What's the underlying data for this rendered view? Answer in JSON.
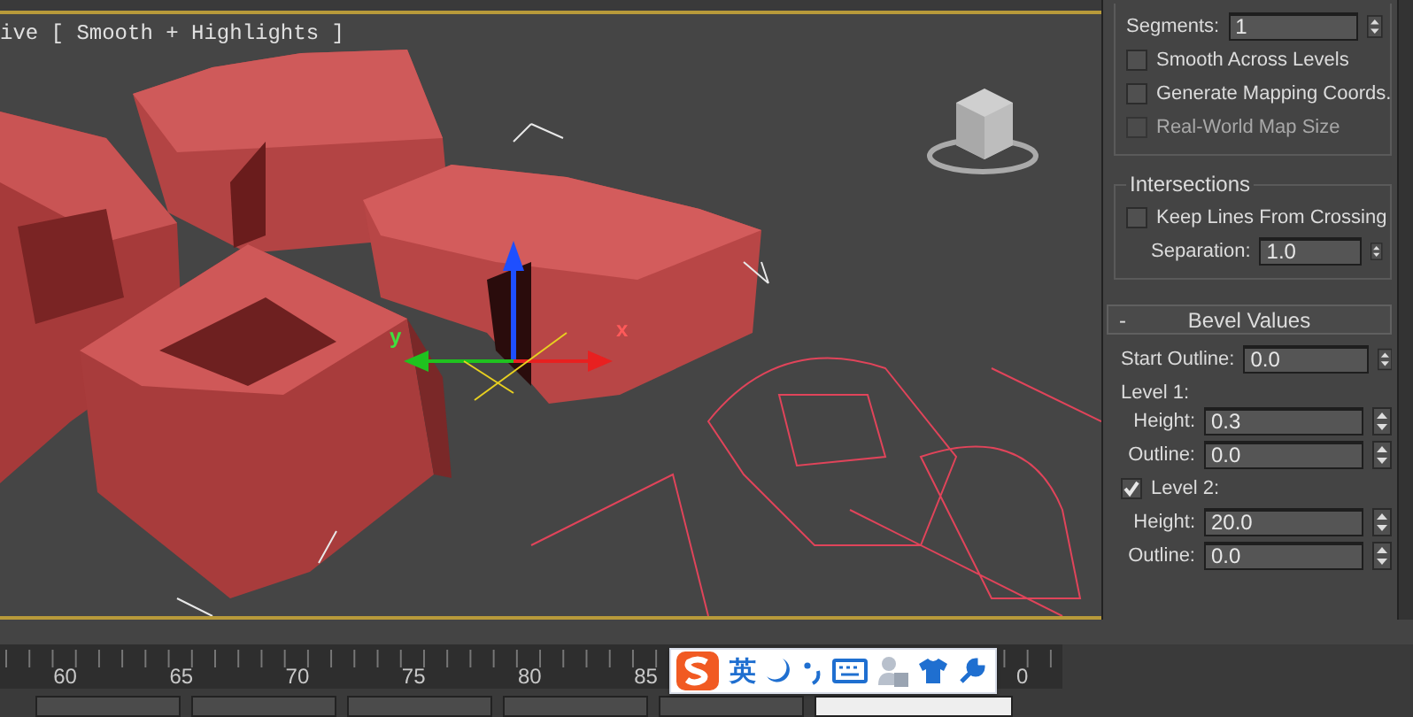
{
  "viewport": {
    "label": "ive [ Smooth + Highlights ]",
    "axis_labels": [
      "y",
      "x"
    ]
  },
  "panel": {
    "segments": {
      "label": "Segments:",
      "value": "1"
    },
    "options": [
      {
        "label": "Smooth Across Levels",
        "checked": false,
        "disabled": false
      },
      {
        "label": "Generate Mapping Coords.",
        "checked": false,
        "disabled": false
      },
      {
        "label": "Real-World Map Size",
        "checked": false,
        "disabled": true
      }
    ],
    "intersections": {
      "title": "Intersections",
      "options": [
        {
          "label": "Keep Lines From Crossing",
          "checked": false,
          "disabled": false
        }
      ],
      "separation": {
        "label": "Separation:",
        "value": "1.0"
      }
    },
    "bevel": {
      "toggle": "-",
      "title": "Bevel Values",
      "rows": [
        {
          "kind": "field",
          "label": "Start Outline:",
          "value": "0.0"
        },
        {
          "kind": "heading",
          "label": "Level 1:"
        },
        {
          "kind": "field",
          "label": "Height:",
          "value": "0.3"
        },
        {
          "kind": "field",
          "label": "Outline:",
          "value": "0.0"
        },
        {
          "kind": "check",
          "label": "Level 2:",
          "checked": true
        },
        {
          "kind": "field",
          "label": "Height:",
          "value": "20.0"
        },
        {
          "kind": "field",
          "label": "Outline:",
          "value": "0.0"
        }
      ]
    }
  },
  "timeline": {
    "ruler_labels": [
      "60",
      "65",
      "70",
      "75",
      "80",
      "85"
    ],
    "ruler_end_label": "0"
  },
  "ime_toolbar": {
    "mode": "英"
  }
}
